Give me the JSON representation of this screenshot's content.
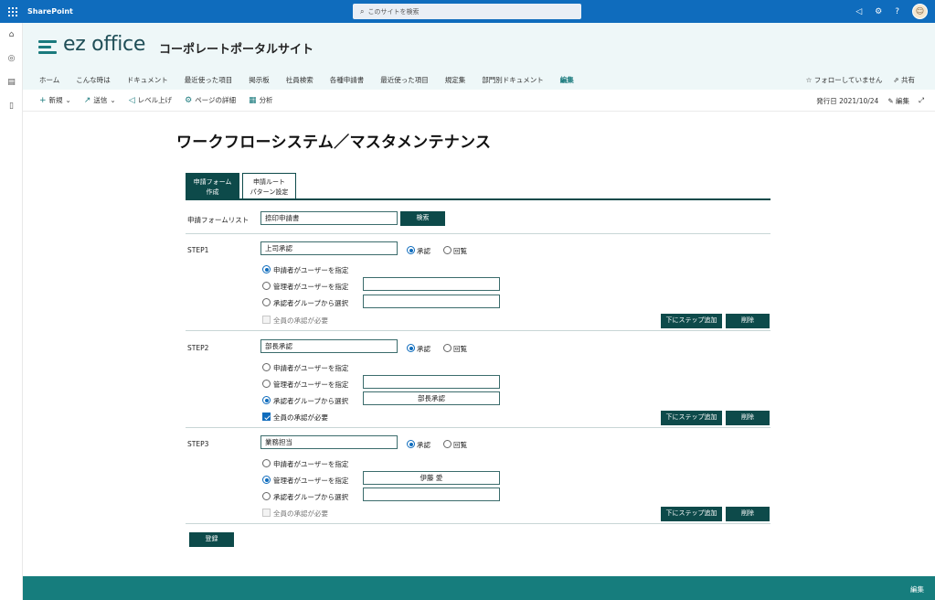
{
  "suite": {
    "app_name": "SharePoint",
    "search_placeholder": "このサイトを検索",
    "help": "?"
  },
  "site": {
    "logo_text": "ez office",
    "title": "コーポレートポータルサイト"
  },
  "nav": {
    "items": [
      "ホーム",
      "こんな時は",
      "ドキュメント",
      "最近使った項目",
      "掲示板",
      "社員検索",
      "各種申請書",
      "最近使った項目",
      "規定集",
      "部門別ドキュメント",
      "編集"
    ],
    "follow": "フォローしていません",
    "share": "共有"
  },
  "commands": {
    "new": "新規",
    "send": "送信",
    "promote": "レベル上げ",
    "page_details": "ページの詳細",
    "analytics": "分析",
    "published": "発行日 2021/10/24",
    "edit": "編集"
  },
  "page": {
    "title": "ワークフローシステム／マスタメンテナンス"
  },
  "tabs": [
    {
      "line1": "申請フォーム",
      "line2": "作成"
    },
    {
      "line1": "申請ルート",
      "line2": "パターン設定"
    }
  ],
  "form": {
    "form_list_label": "申請フォームリスト",
    "form_list_value": "捺印申請書",
    "search_button": "検索",
    "approve_label": "承認",
    "circulate_label": "回覧",
    "opt_applicant": "申請者がユーザーを指定",
    "opt_admin": "管理者がユーザーを指定",
    "opt_group": "承認者グループから選択",
    "opt_all": "全員の承認が必要",
    "add_step_button": "下にステップ追加",
    "delete_button": "削除",
    "register_button": "登録",
    "steps": [
      {
        "label": "STEP1",
        "name": "上司承認",
        "admin_value": "",
        "group_value": ""
      },
      {
        "label": "STEP2",
        "name": "部長承認",
        "admin_value": "",
        "group_value": "部長承認"
      },
      {
        "label": "STEP3",
        "name": "業務担当",
        "admin_value": "伊藤 愛",
        "group_value": ""
      }
    ]
  },
  "footer": {
    "edit": "編集"
  }
}
